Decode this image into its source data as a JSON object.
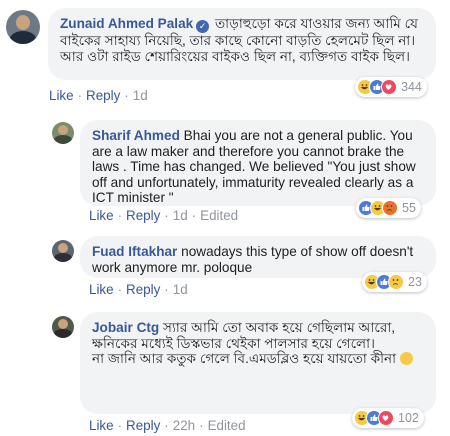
{
  "comments": [
    {
      "author": "Zunaid Ahmed Palak",
      "verified": true,
      "text": "তাড়াহুড়ো করে যাওয়ার জন্য আমি যে বাইকের সাহায্য নিয়েছি, তার কাছে কোনো বাড়তি হেলমেট ছিল না। আর ওটা রাইড শেয়ারিংয়ের বাইকও ছিল না, ব্যক্তিগত বাইক ছিল।",
      "like_label": "Like",
      "reply_label": "Reply",
      "time": "1d",
      "edited_label": "",
      "reactions": [
        "haha",
        "like",
        "love"
      ],
      "reaction_count": "344"
    },
    {
      "author": "Sharif Ahmed",
      "verified": false,
      "text": "Bhai you are not a general public. You are a law maker and therefore you cannot brake the laws . Time has changed. We believed \"You just show off and unfortunately, immaturity revealed clearly as a ICT minister \"",
      "like_label": "Like",
      "reply_label": "Reply",
      "time": "1d",
      "edited_label": "Edited",
      "reactions": [
        "like",
        "haha",
        "angry"
      ],
      "reaction_count": "55"
    },
    {
      "author": "Fuad Iftakhar",
      "verified": false,
      "text": "nowadays this type of show off doesn't work anymore mr. poloque",
      "like_label": "Like",
      "reply_label": "Reply",
      "time": "1d",
      "edited_label": "",
      "reactions": [
        "haha",
        "like",
        "sad"
      ],
      "reaction_count": "23"
    },
    {
      "author": "Jobair Ctg",
      "verified": false,
      "text": "স্যার আমি তো অবাক হয়ে গেছিলাম আরো,\nক্ষনিকের মধ্যেই ডিস্কভার থেইকা পালসার হয়ে গেলো।\nনা জানি আর কতুক গেলে বি.এমডব্লিও হয়ে যায়তো কীনা",
      "like_label": "Like",
      "reply_label": "Reply",
      "time": "22h",
      "edited_label": "Edited",
      "reactions": [
        "haha",
        "like",
        "love"
      ],
      "reaction_count": "102"
    }
  ],
  "colors": {
    "bubble": "#f2f3f5",
    "link": "#385898",
    "meta": "#90949c"
  }
}
